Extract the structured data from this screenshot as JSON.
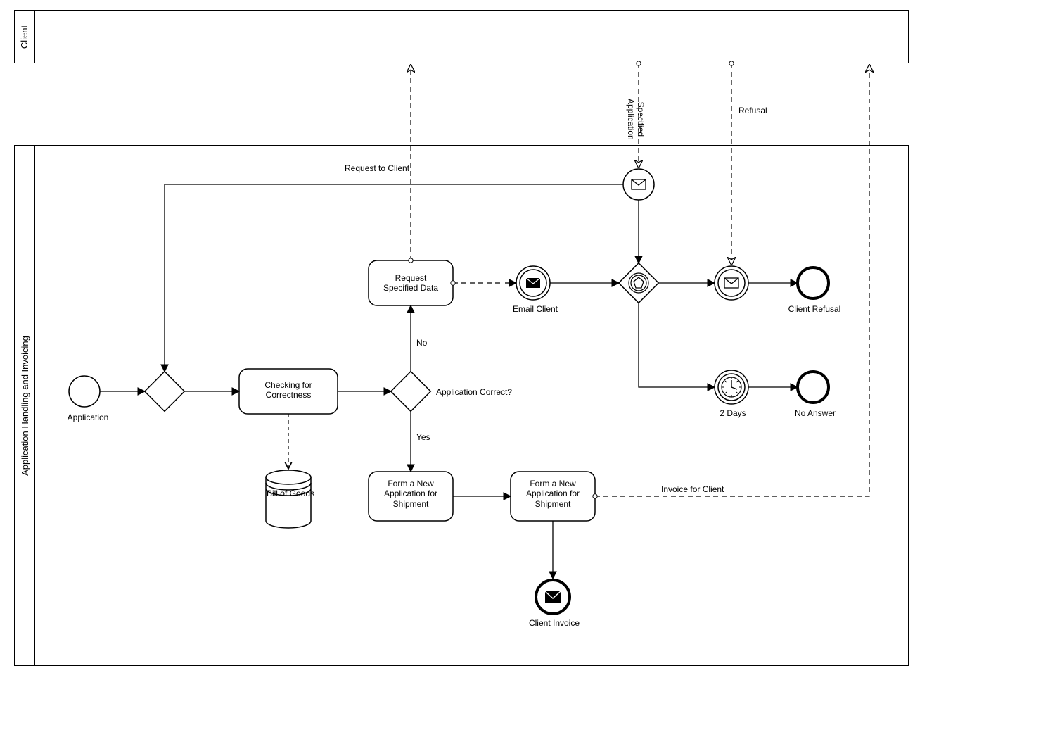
{
  "chart_data": {
    "type": "bpmn-diagram",
    "pools": [
      {
        "id": "client",
        "name": "Client"
      },
      {
        "id": "handling",
        "name": "Application Handling and Invoicing"
      }
    ],
    "nodes": [
      {
        "id": "start",
        "pool": "handling",
        "type": "start-event",
        "label": "Application"
      },
      {
        "id": "gw_merge",
        "pool": "handling",
        "type": "exclusive-gateway",
        "label": ""
      },
      {
        "id": "check",
        "pool": "handling",
        "type": "task",
        "label": "Checking for Correctness"
      },
      {
        "id": "bill_store",
        "pool": "handling",
        "type": "data-store",
        "label": "Bill of Goods"
      },
      {
        "id": "gw_correct",
        "pool": "handling",
        "type": "exclusive-gateway",
        "label": "Application Correct?"
      },
      {
        "id": "req_data",
        "pool": "handling",
        "type": "task",
        "label": "Request Specified Data"
      },
      {
        "id": "email_client",
        "pool": "handling",
        "type": "message-intermediate-throw",
        "label": "Email Client"
      },
      {
        "id": "msg_catch",
        "pool": "handling",
        "type": "message-intermediate-catch",
        "label": ""
      },
      {
        "id": "gw_event",
        "pool": "handling",
        "type": "event-based-gateway",
        "label": ""
      },
      {
        "id": "refusal_msg",
        "pool": "handling",
        "type": "message-intermediate-catch",
        "label": ""
      },
      {
        "id": "end_refusal",
        "pool": "handling",
        "type": "end-event",
        "label": "Client Refusal"
      },
      {
        "id": "timer",
        "pool": "handling",
        "type": "timer-intermediate",
        "label": "2 Days"
      },
      {
        "id": "end_noanswer",
        "pool": "handling",
        "type": "end-event",
        "label": "No Answer"
      },
      {
        "id": "form1",
        "pool": "handling",
        "type": "task",
        "label": "Form a New Application for Shipment"
      },
      {
        "id": "form2",
        "pool": "handling",
        "type": "task",
        "label": "Form a New Application for Shipment"
      },
      {
        "id": "end_invoice",
        "pool": "handling",
        "type": "message-end-event",
        "label": "Client Invoice"
      }
    ],
    "sequence_flows": [
      {
        "from": "start",
        "to": "gw_merge"
      },
      {
        "from": "gw_merge",
        "to": "check"
      },
      {
        "from": "check",
        "to": "gw_correct"
      },
      {
        "from": "gw_correct",
        "to": "req_data",
        "condition": "No"
      },
      {
        "from": "gw_correct",
        "to": "form1",
        "condition": "Yes"
      },
      {
        "from": "req_data",
        "to": "email_client"
      },
      {
        "from": "email_client",
        "to": "gw_event"
      },
      {
        "from": "gw_event",
        "to": "refusal_msg"
      },
      {
        "from": "refusal_msg",
        "to": "end_refusal"
      },
      {
        "from": "gw_event",
        "to": "timer"
      },
      {
        "from": "timer",
        "to": "end_noanswer"
      },
      {
        "from": "msg_catch",
        "to": "gw_merge"
      },
      {
        "from": "msg_catch",
        "to": "gw_event"
      },
      {
        "from": "form1",
        "to": "form2"
      },
      {
        "from": "form2",
        "to": "end_invoice"
      }
    ],
    "data_associations": [
      {
        "from": "check",
        "to": "bill_store"
      }
    ],
    "message_flows": [
      {
        "from": "req_data",
        "to_pool": "client",
        "label": "Request to Client"
      },
      {
        "from_pool": "client",
        "to": "msg_catch",
        "label": "Specified Application"
      },
      {
        "from_pool": "client",
        "to": "refusal_msg",
        "label": "Refusal"
      },
      {
        "from": "form2",
        "to_pool": "client",
        "label": "Invoice for Client"
      }
    ]
  },
  "labels": {
    "pool_client": "Client",
    "pool_handling": "Application Handling and Invoicing",
    "start": "Application",
    "check": "Checking for\nCorrectness",
    "bill_store": "Bill of Goods",
    "gw_correct": "Application Correct?",
    "req_data": "Request\nSpecified Data",
    "email_client": "Email Client",
    "end_refusal": "Client Refusal",
    "timer": "2 Days",
    "end_noanswer": "No Answer",
    "form1": "Form a New\nApplication for\nShipment",
    "form2": "Form a New\nApplication for\nShipment",
    "end_invoice": "Client Invoice",
    "cond_no": "No",
    "cond_yes": "Yes",
    "mf_request": "Request to Client",
    "mf_specified": "Specified\nApplication",
    "mf_refusal": "Refusal",
    "mf_invoice": "Invoice for Client"
  }
}
